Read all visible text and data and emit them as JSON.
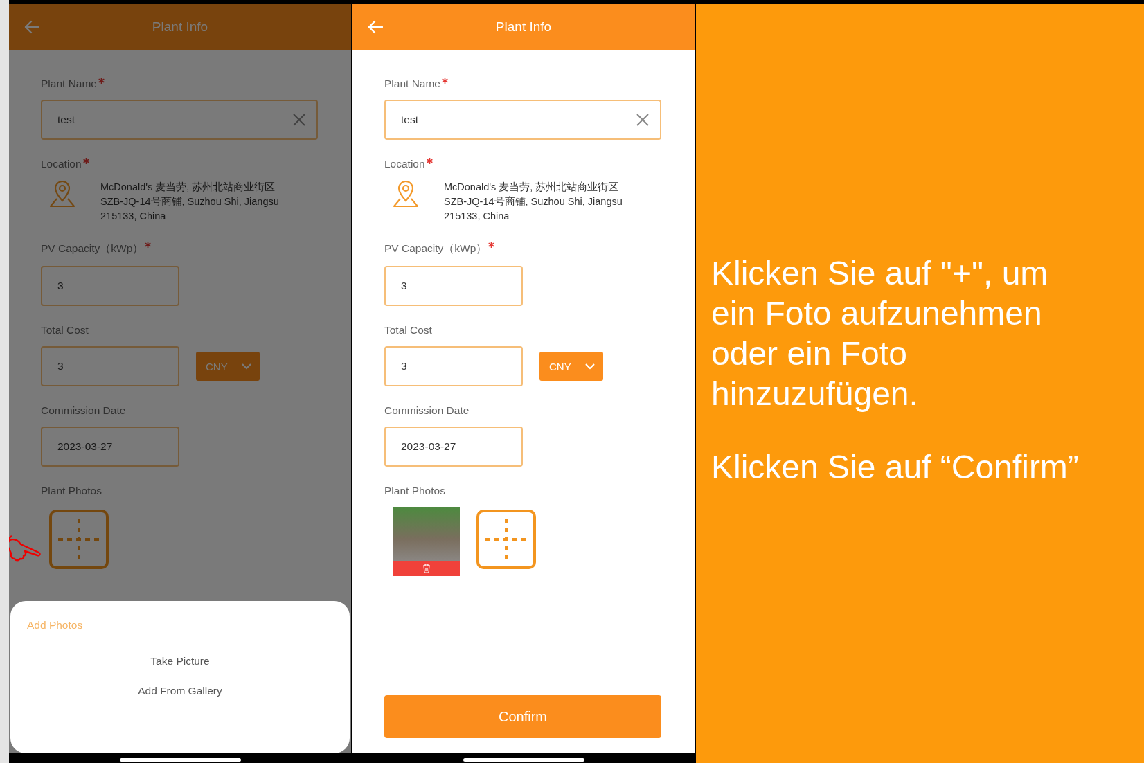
{
  "screens": [
    {
      "dimmed": true,
      "header": {
        "title": "Plant Info"
      },
      "fields": [
        {
          "kind": "text",
          "label": "Plant Name",
          "required": true,
          "value": "test",
          "clearable": true
        },
        {
          "kind": "location",
          "label": "Location",
          "required": true,
          "address_lines": [
            "McDonald's 麦当劳, 苏州北站商业街区",
            "SZB-JQ-14号商铺, Suzhou Shi, Jiangsu",
            "215133, China"
          ]
        },
        {
          "kind": "short",
          "label": "PV Capacity（kWp）",
          "required": true,
          "value": "3"
        },
        {
          "kind": "currency",
          "label": "Total Cost",
          "required": false,
          "value": "3",
          "currency": "CNY"
        },
        {
          "kind": "short",
          "label": "Commission Date",
          "required": false,
          "value": "2023-03-27"
        },
        {
          "kind": "photos",
          "label": "Plant Photos",
          "required": false
        }
      ],
      "sheet": {
        "title": "Add Photos",
        "options": [
          "Take Picture",
          "Add From Gallery"
        ]
      }
    },
    {
      "dimmed": false,
      "header": {
        "title": "Plant Info"
      },
      "fields": [
        {
          "kind": "text",
          "label": "Plant Name",
          "required": true,
          "value": "test",
          "clearable": true
        },
        {
          "kind": "location",
          "label": "Location",
          "required": true,
          "address_lines": [
            "McDonald's 麦当劳, 苏州北站商业街区",
            "SZB-JQ-14号商铺, Suzhou Shi, Jiangsu",
            "215133, China"
          ]
        },
        {
          "kind": "short",
          "label": "PV Capacity（kWp）",
          "required": true,
          "value": "3"
        },
        {
          "kind": "currency",
          "label": "Total Cost",
          "required": false,
          "value": "3",
          "currency": "CNY"
        },
        {
          "kind": "short",
          "label": "Commission Date",
          "required": false,
          "value": "2023-03-27"
        },
        {
          "kind": "photos",
          "label": "Plant Photos",
          "required": false,
          "photos": [
            {
              "deletable": true
            }
          ]
        }
      ],
      "button": "Confirm"
    }
  ],
  "instructions": [
    "Klicken Sie auf \"+\", um ein Foto aufzunehmen oder ein Foto hinzuzufügen.",
    "Klicken Sie auf “Confirm”"
  ]
}
